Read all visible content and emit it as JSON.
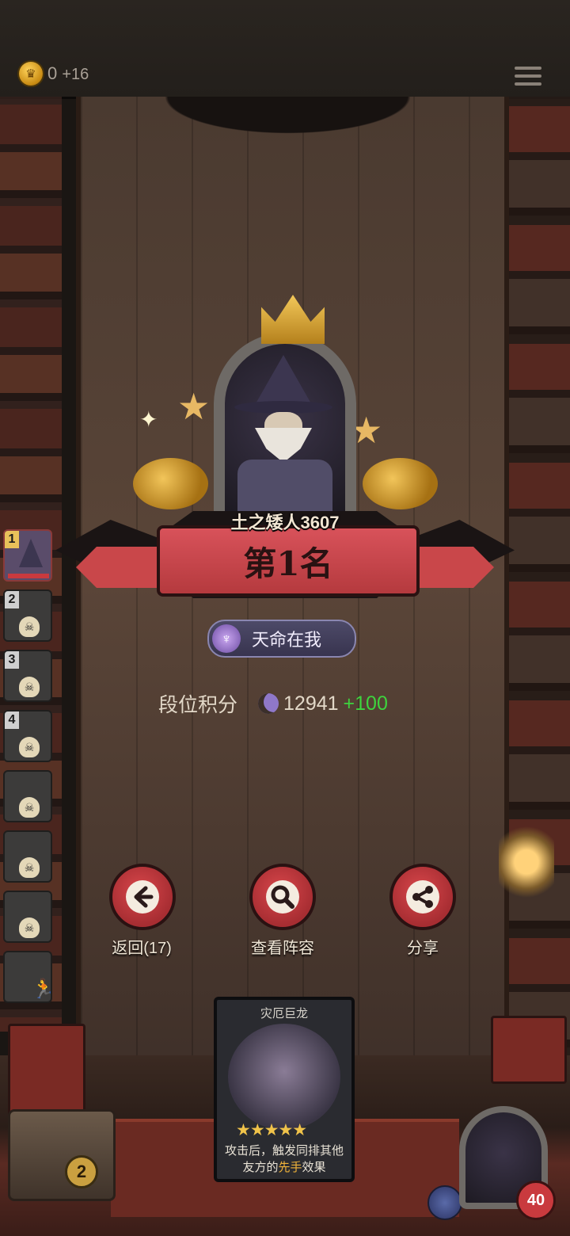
{
  "header": {
    "coin_count": "0",
    "coin_gain": "+16",
    "menu_icon": "hamburger-menu-icon"
  },
  "result": {
    "player_name": "土之矮人3607",
    "rank": "第1名",
    "title_badge": "天命在我",
    "score_label": "段位积分",
    "score_value": "12941",
    "score_gain": "+100"
  },
  "actions": [
    {
      "label": "返回(17)",
      "icon": "arrow-left-icon"
    },
    {
      "label": "查看阵容",
      "icon": "magnifier-icon"
    },
    {
      "label": "分享",
      "icon": "share-icon"
    }
  ],
  "rank_list": [
    {
      "num": "1"
    },
    {
      "num": "2"
    },
    {
      "num": "3"
    },
    {
      "num": "4"
    },
    {
      "num": ""
    },
    {
      "num": ""
    },
    {
      "num": ""
    },
    {
      "num": ""
    }
  ],
  "card": {
    "name": "灾厄巨龙",
    "stars": 5,
    "desc_part1": "攻击后，触发同排其他友方的",
    "desc_highlight": "先手",
    "desc_part2": "效果"
  },
  "bottom": {
    "chest_count": "2",
    "hp": "40"
  },
  "colors": {
    "gain_green": "#3ed33e",
    "button_red": "#c63a3f",
    "highlight_gold": "#f0b33a"
  }
}
